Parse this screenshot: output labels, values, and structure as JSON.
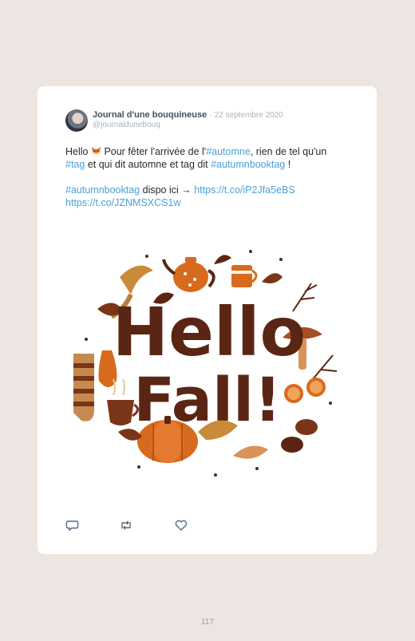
{
  "tweet": {
    "author_name": "Journal d'une bouquineuse",
    "separator": "·",
    "date": "22 septembre 2020",
    "handle": "@journaldunebouq",
    "line1": {
      "prefix": "Hello ",
      "emoji": "fox-emoji",
      "middle": " Pour fêter l'arrivée de l'",
      "hashtag_automne": "#automne",
      "suffix": ", rien de tel qu'un"
    },
    "line2": {
      "hashtag_tag": "#tag",
      "middle": " et qui dit automne et tag dit ",
      "hashtag_autumnbooktag": "#autumnbooktag",
      "suffix": " !"
    },
    "paragraph2": {
      "hashtag": "#autumnbooktag",
      "middle": " dispo ici → ",
      "link1": "https://t.co/iP2Jfa5eBS",
      "link2": "https://t.co/JZNMSXCS1w"
    }
  },
  "media": {
    "text_line1": "Hello",
    "text_line2": "Fall!",
    "illustration": "autumn-illustration"
  },
  "actions": [
    "reply-icon",
    "retweet-icon",
    "like-icon"
  ],
  "page": {
    "number": "117"
  },
  "colors": {
    "background": "#ede5e2",
    "card": "#ffffff",
    "link": "#4aa1d8",
    "hello_fall_text": "#5a2613",
    "accent_orange": "#d86a1e"
  }
}
